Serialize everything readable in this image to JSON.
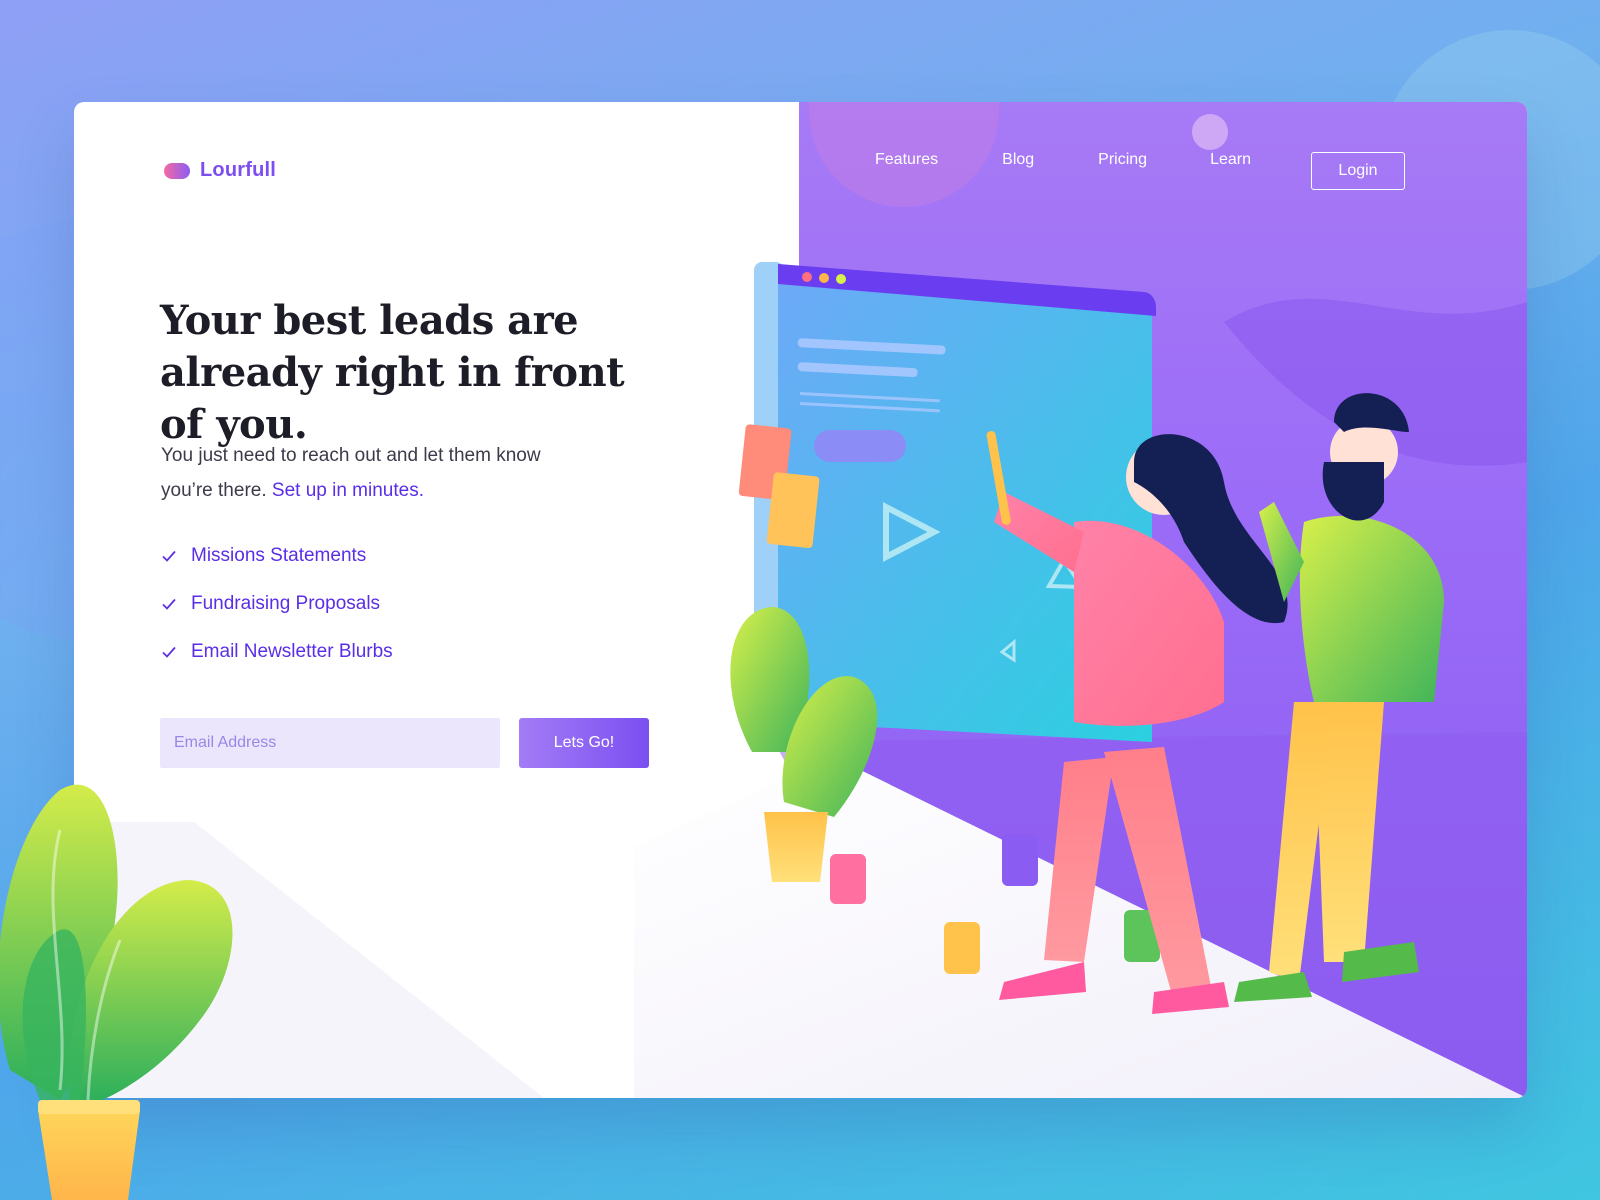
{
  "brand": {
    "name": "Lourfull",
    "logo_icon": "pill-logo-icon"
  },
  "nav": {
    "items": [
      {
        "label": "Features"
      },
      {
        "label": "Blog"
      },
      {
        "label": "Pricing"
      },
      {
        "label": "Learn"
      }
    ],
    "login_label": "Login"
  },
  "hero": {
    "headline": "Your best leads are already right in front of you.",
    "subtext": "You just need to reach out and let them know you’re there.",
    "subtext_link": "Set up in minutes.",
    "features": [
      {
        "label": "Missions Statements",
        "icon": "check-icon"
      },
      {
        "label": "Fundraising Proposals",
        "icon": "check-icon"
      },
      {
        "label": "Email Newsletter Blurbs",
        "icon": "check-icon"
      }
    ],
    "form": {
      "email_value": "",
      "email_placeholder": "Email Address",
      "submit_label": "Lets Go!"
    }
  },
  "colors": {
    "accent": "#5a2ee6",
    "brand": "#7c4df0",
    "panel_purple": "#9b6cf7",
    "input_bg": "#ece6fd"
  }
}
